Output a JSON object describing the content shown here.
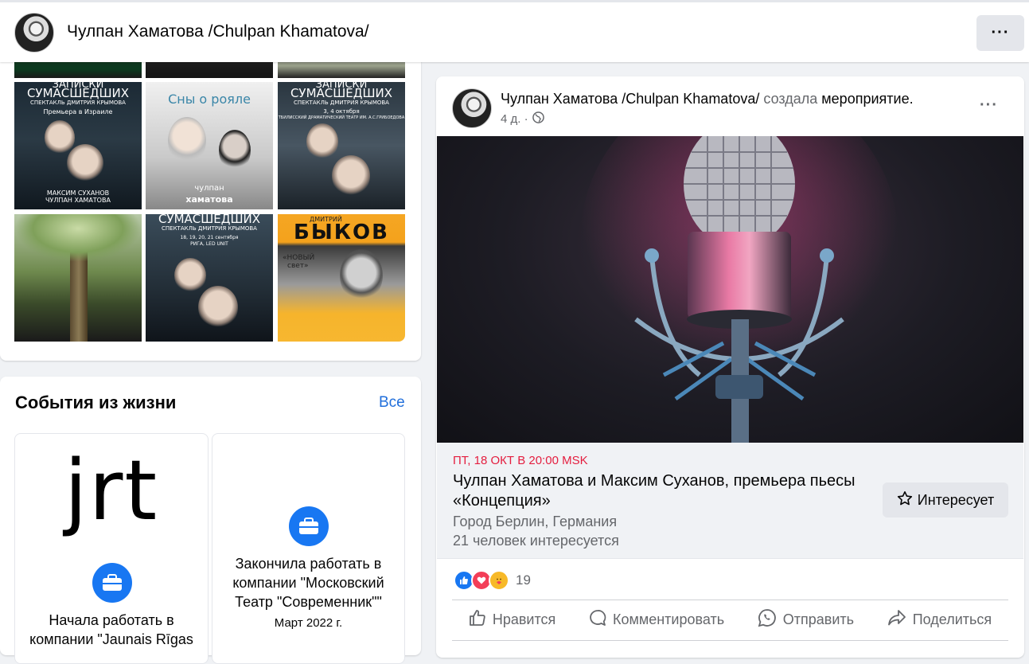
{
  "topbar": {
    "profile_name": "Чулпан Хаматова /Chulpan Khamatova/",
    "more_label": "···",
    "avatar_icon": "profile-avatar"
  },
  "photos": {
    "tiles": [
      {
        "title": "ЗАПИСКИ",
        "subtitle": "СУМАСШЕДШИХ",
        "line1": "СПЕКТАКЛЬ ДМИТРИЯ КРЫМОВА",
        "line2": "Премьера в Израиле",
        "line3": "МАКСИМ СУХАНОВ",
        "line4": "ЧУЛПАН ХАМАТОВА"
      },
      {
        "title": "Сны о рояле",
        "line1": "чулпан",
        "line2": "хаматова"
      },
      {
        "title": "ЗАПИСКИ",
        "subtitle": "СУМАСШЕДШИХ",
        "line1": "СПЕКТАКЛЬ ДМИТРИЯ КРЫМОВА",
        "line2": "3, 4 октября",
        "line3": "ТБИЛИССКИЙ ДРАМАТИЧЕСКИЙ ТЕАТР ИМ. А.С.ГРИБОЕДОВА"
      },
      {
        "title": ""
      },
      {
        "title": "СУМАСШЕДШИХ",
        "line1": "СПЕКТАКЛЬ ДМИТРИЯ КРЫМОВА",
        "line2": "18, 19, 20, 21 сентября",
        "line3": "РИГА, LED UNIT"
      },
      {
        "title": "БЫКОВ",
        "subtitle": "ДМИТРИЙ",
        "line1": "«НОВЫЙ",
        "line2": "свет»"
      }
    ]
  },
  "events": {
    "title": "События из жизни",
    "all_label": "Все",
    "items": [
      {
        "logo_text": "jrt",
        "text": "Начала работать в компании \"Jaunais Rīgas",
        "icon": "briefcase-icon"
      },
      {
        "text": "Закончила работать в компании \"Московский Театр \"Современник\"\"",
        "date": "Март 2022 г.",
        "icon": "briefcase-icon"
      }
    ]
  },
  "post": {
    "author": "Чулпан Хаматова /Chulpan Khamatova/",
    "action_text": "создала",
    "object_text": "мероприятие.",
    "time": "4 д. ·",
    "privacy_icon": "globe-icon",
    "more_label": "···",
    "event": {
      "datetime": "ПТ, 18 ОКТ В 20:00 MSK",
      "name": "Чулпан Хаматова и Максим Суханов, премьера пьесы «Концепция»",
      "location": "Город Берлин, Германия",
      "interested_count": "21 человек интересуется",
      "interest_button": "Интересует"
    },
    "reactions": {
      "types": [
        "like",
        "love",
        "care"
      ],
      "count": "19"
    },
    "actions": {
      "like": "Нравится",
      "comment": "Комментировать",
      "send": "Отправить",
      "share": "Поделиться"
    }
  }
}
